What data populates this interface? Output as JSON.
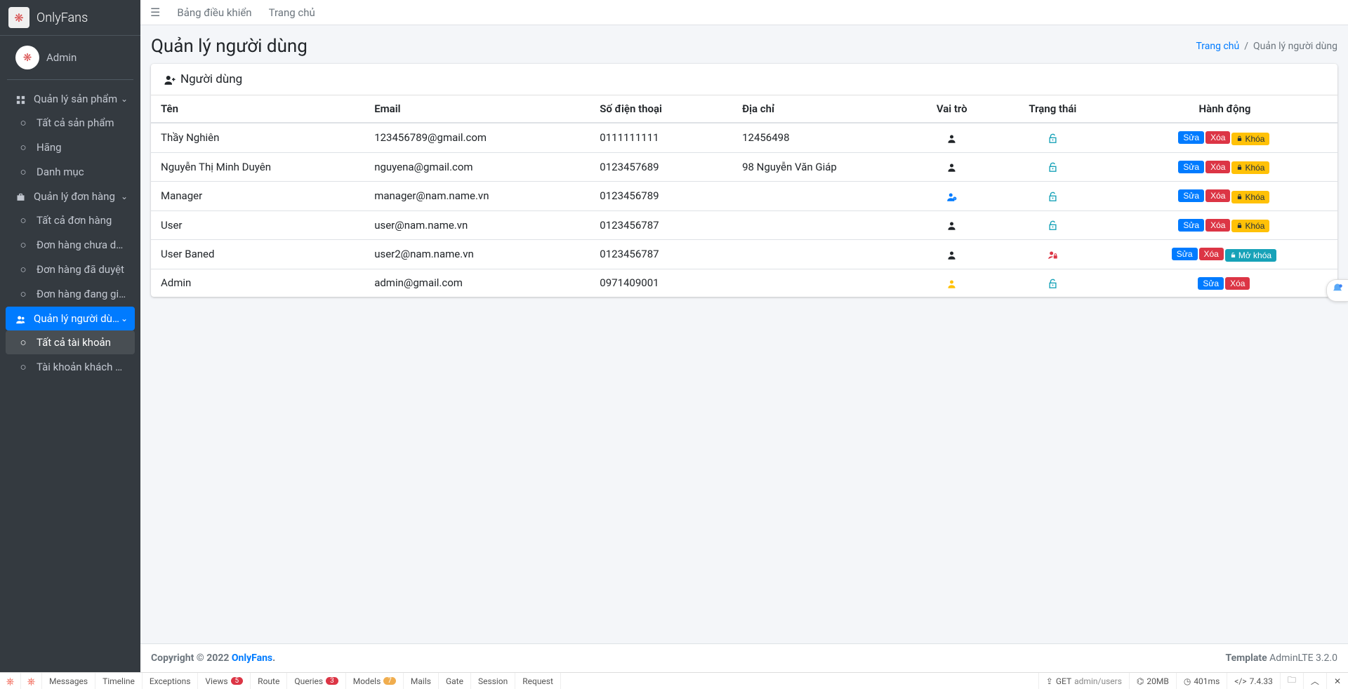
{
  "brand": {
    "name": "OnlyFans"
  },
  "user": {
    "name": "Admin"
  },
  "topnav": {
    "dashboard": "Bảng điều khiển",
    "home": "Trang chủ"
  },
  "sidebar": {
    "products": {
      "label": "Quản lý sản phẩm",
      "children": [
        {
          "label": "Tất cả sản phẩm"
        },
        {
          "label": "Hãng"
        },
        {
          "label": "Danh mục"
        }
      ]
    },
    "orders": {
      "label": "Quản lý đơn hàng",
      "children": [
        {
          "label": "Tất cả đơn hàng"
        },
        {
          "label": "Đơn hàng chưa duyệt"
        },
        {
          "label": "Đơn hàng đã duyệt"
        },
        {
          "label": "Đơn hàng đang giao"
        }
      ]
    },
    "users": {
      "label": "Quản lý người dùng",
      "children": [
        {
          "label": "Tất cả tài khoản"
        },
        {
          "label": "Tài khoản khách hàng"
        }
      ]
    }
  },
  "page": {
    "title": "Quản lý người dùng",
    "breadcrumb_home": "Trang chủ",
    "breadcrumb_current": "Quản lý người dùng",
    "card_title": "Người dùng"
  },
  "table": {
    "headers": {
      "name": "Tên",
      "email": "Email",
      "phone": "Số điện thoại",
      "address": "Địa chỉ",
      "role": "Vai trò",
      "status": "Trạng thái",
      "actions": "Hành động"
    },
    "actions": {
      "edit": "Sửa",
      "delete": "Xóa",
      "lock": "Khóa",
      "unlock": "Mở khóa"
    },
    "rows": [
      {
        "name": "Thầy Nghiên",
        "email": "123456789@gmail.com",
        "phone": "0111111111",
        "address": "12456498",
        "role": "user",
        "status": "open",
        "lockable": true
      },
      {
        "name": "Nguyễn Thị Minh Duyên",
        "email": "nguyena@gmail.com",
        "phone": "0123457689",
        "address": "98 Nguyễn Văn Giáp",
        "role": "user",
        "status": "open",
        "lockable": true
      },
      {
        "name": "Manager",
        "email": "manager@nam.name.vn",
        "phone": "0123456789",
        "address": "",
        "role": "manager",
        "status": "open",
        "lockable": true
      },
      {
        "name": "User",
        "email": "user@nam.name.vn",
        "phone": "0123456787",
        "address": "",
        "role": "user",
        "status": "open",
        "lockable": true
      },
      {
        "name": "User Baned",
        "email": "user2@nam.name.vn",
        "phone": "0123456787",
        "address": "",
        "role": "user",
        "status": "banned",
        "lockable": true
      },
      {
        "name": "Admin",
        "email": "admin@gmail.com",
        "phone": "0971409001",
        "address": "",
        "role": "admin",
        "status": "open",
        "lockable": false
      }
    ]
  },
  "footer": {
    "copyright_prefix": "Copyright © 2022 ",
    "copyright_link": "OnlyFans",
    "copyright_suffix": ".",
    "template_label": "Template",
    "template_value": " AdminLTE 3.2.0"
  },
  "debugbar": {
    "tabs": {
      "messages": "Messages",
      "timeline": "Timeline",
      "exceptions": "Exceptions",
      "views": "Views",
      "views_count": "5",
      "route": "Route",
      "queries": "Queries",
      "queries_count": "3",
      "models": "Models",
      "models_count": "7",
      "mails": "Mails",
      "gate": "Gate",
      "session": "Session",
      "request": "Request"
    },
    "right": {
      "method": "GET",
      "path": "admin/users",
      "memory": "20MB",
      "time": "401ms",
      "php": "7.4.33"
    }
  }
}
